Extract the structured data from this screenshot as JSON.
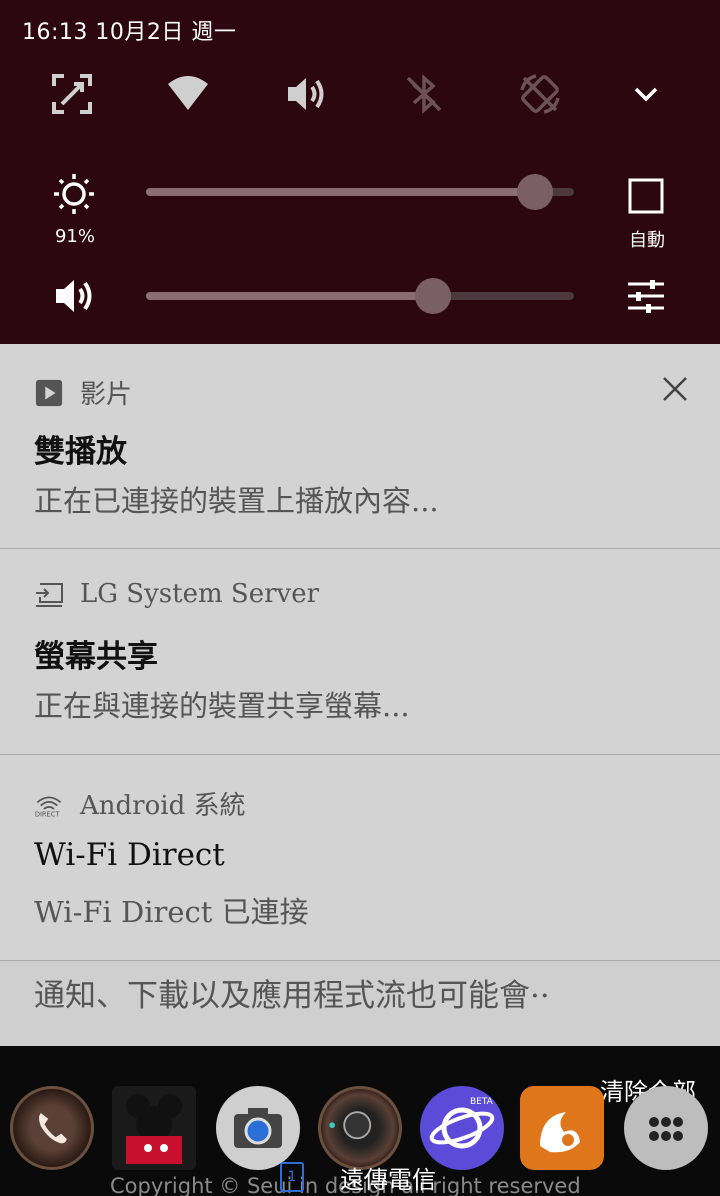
{
  "status": {
    "time": "16:13",
    "date": "10月2日",
    "weekday": "週一"
  },
  "quick_settings": {
    "tiles": [
      {
        "icon": "screen-capture-icon"
      },
      {
        "icon": "wifi-icon"
      },
      {
        "icon": "sound-icon"
      },
      {
        "icon": "bluetooth-off-icon"
      },
      {
        "icon": "auto-rotate-off-icon"
      },
      {
        "icon": "expand-chevron-icon"
      }
    ],
    "brightness": {
      "label": "91%",
      "level": 0.91,
      "auto_label": "自動"
    },
    "volume": {
      "level": 0.67
    }
  },
  "notifications": [
    {
      "app": "影片",
      "icon": "play-icon",
      "title": "雙播放",
      "text": "正在已連接的裝置上播放內容...",
      "dismissible": true
    },
    {
      "app": "LG System Server",
      "icon": "screen-share-icon",
      "title": "螢幕共享",
      "text": "正在與連接的裝置共享螢幕..."
    },
    {
      "app": "Android 系統",
      "icon": "wifi-direct-icon",
      "title": "Wi-Fi Direct",
      "text": "Wi-Fi Direct 已連接"
    }
  ],
  "hint": "通知、下載以及應用程式流也可能會··",
  "home": {
    "clear_all": "清除全部",
    "carrier": "遠傳電信",
    "page_indicator": "1",
    "copyright": "Copyright © Seui in design all right reserved",
    "dock": [
      "phone-app-icon",
      "mickey-app-icon",
      "camera-app-icon",
      "camera2-app-icon",
      "browser-beta-app-icon",
      "uc-browser-app-icon",
      "app-drawer-icon"
    ]
  },
  "colors": {
    "shade_bg": "#2c0710",
    "notif_bg": "#d3d3d3",
    "slider_thumb": "#7a5f64"
  }
}
